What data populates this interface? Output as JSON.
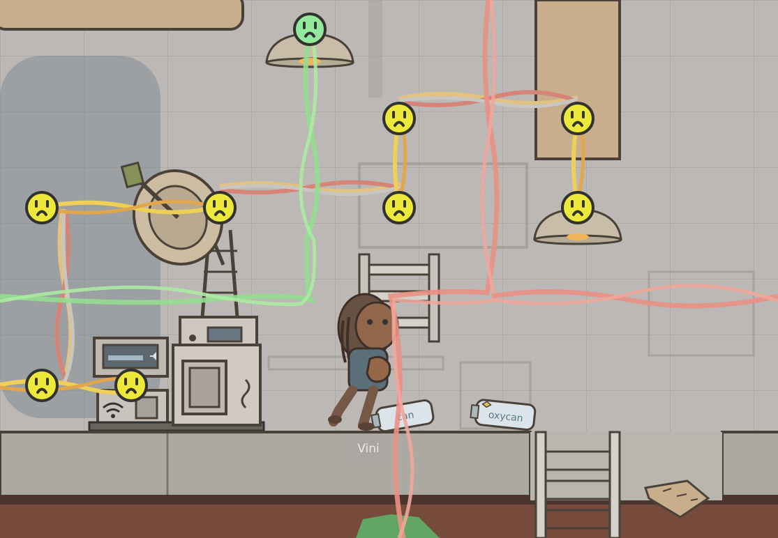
{
  "game": {
    "duplicant_name": "Vini",
    "item_label_canister": "oxycan",
    "item_label_canister_partial": "can"
  },
  "colors": {
    "background_wall": "#b9b6b3",
    "floor_tile": "#a9a5a0",
    "soil": "#6b3b2a",
    "wire_green": "#8ee08a",
    "wire_red": "#f08a7d",
    "wire_yellow": "#f4d24a",
    "wire_heavy_braid": [
      "#e5c27c",
      "#c9c6c2",
      "#d97b6e"
    ],
    "power_node_yellow": "#f3ee2a",
    "power_node_green": "#8ef098",
    "node_outline": "#1e1e1e"
  },
  "icons": {
    "power_node": "plug-socket-icon",
    "wifi": "wifi-icon",
    "speaker": "speaker-icon"
  }
}
